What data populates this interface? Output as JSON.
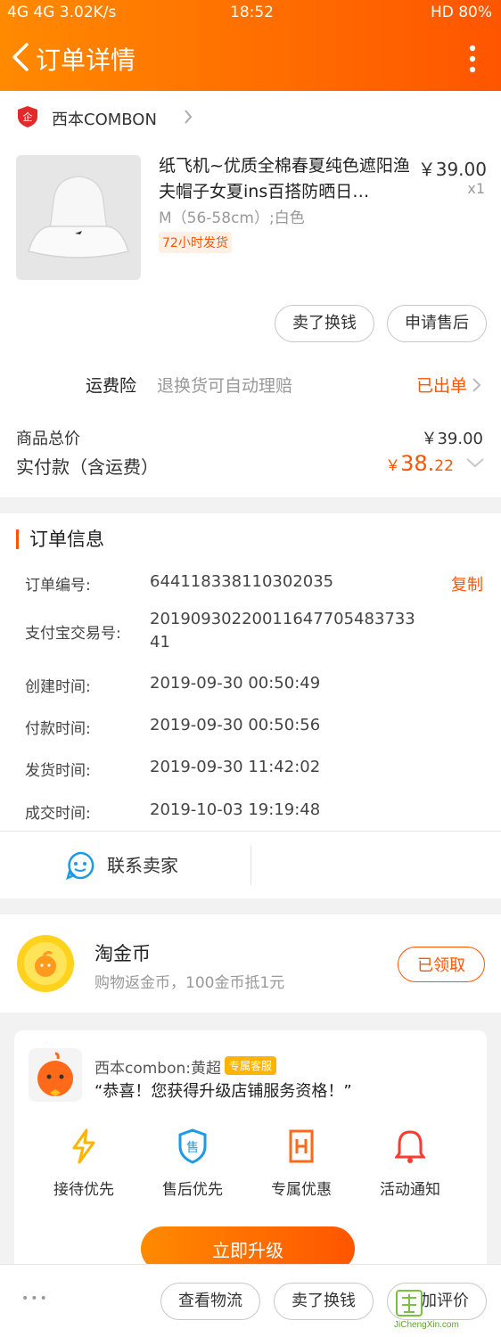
{
  "status_bar": {
    "left": "4G 4G 3.02K/s",
    "time": "18:52",
    "battery": "HD 80%"
  },
  "nav": {
    "title": "订单详情"
  },
  "shop": {
    "name": "西本COMBON"
  },
  "product": {
    "title": "纸飞机~优质全棉春夏纯色遮阳渔夫帽子女夏ins百搭防晒日…",
    "price": "￥39.00",
    "qty": "x1",
    "sku": "M（56-58cm）;白色",
    "tag": "72小时发货"
  },
  "actions": {
    "sell": "卖了换钱",
    "after_sale": "申请售后"
  },
  "insurance": {
    "label": "运费险",
    "desc": "退换货可自动理赔",
    "status": "已出单"
  },
  "summary": {
    "goods_total_label": "商品总价",
    "goods_total": "￥39.00",
    "paid_label": "实付款（含运费）",
    "paid_currency": "￥",
    "paid_int": "38.",
    "paid_dec": "22"
  },
  "order_info": {
    "title": "订单信息",
    "copy_label": "复制",
    "rows": [
      {
        "label": "订单编号:",
        "value": "644118338110302035"
      },
      {
        "label": "支付宝交易号:",
        "value": "2019093022001164770548373341"
      },
      {
        "label": "创建时间:",
        "value": "2019-09-30 00:50:49"
      },
      {
        "label": "付款时间:",
        "value": "2019-09-30 00:50:56"
      },
      {
        "label": "发货时间:",
        "value": "2019-09-30 11:42:02"
      },
      {
        "label": "成交时间:",
        "value": "2019-10-03 19:19:48"
      }
    ],
    "contact_label": "联系卖家"
  },
  "coin": {
    "title": "淘金币",
    "desc": "购物返金币，100金币抵1元",
    "button": "已领取"
  },
  "promo": {
    "name": "西本combon:黄超",
    "badge": "专属客服",
    "message": "“恭喜！您获得升级店铺服务资格！”",
    "features": [
      "接待优先",
      "售后优先",
      "专属优惠",
      "活动通知"
    ],
    "upgrade_button": "立即升级"
  },
  "bottom_bar": {
    "more": "•••",
    "logistics": "查看物流",
    "sell": "卖了换钱",
    "review": "追加评价"
  },
  "watermark": {
    "text": "JiChengXin.com"
  },
  "colors": {
    "accent": "#ff5500",
    "header_start": "#ff8a00",
    "header_end": "#ff5500"
  }
}
